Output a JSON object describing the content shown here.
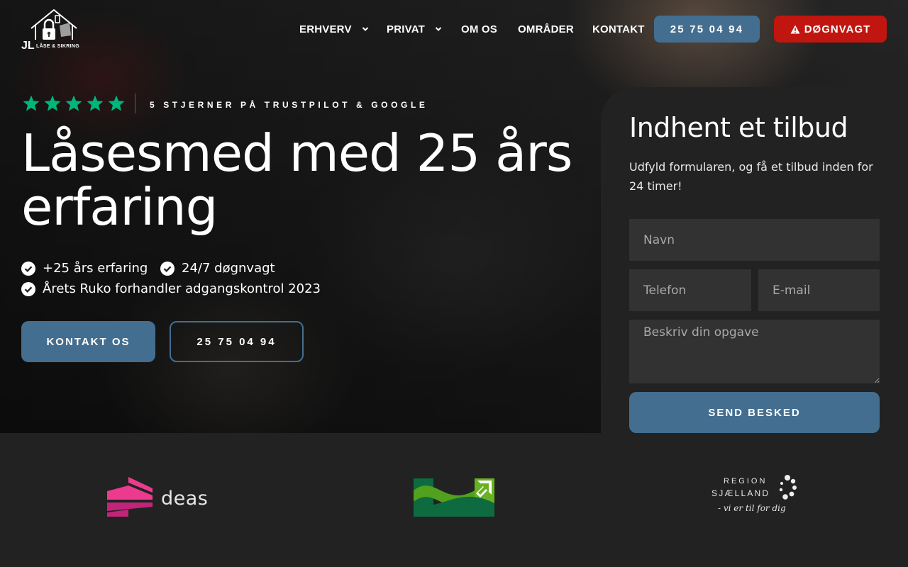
{
  "header": {
    "logo_text": "JL",
    "logo_subtext": "LÅSE & SIKRING",
    "nav": [
      {
        "label": "ERHVERV"
      },
      {
        "label": "PRIVAT"
      },
      {
        "label": "OM OS"
      },
      {
        "label": "OMRÅDER"
      },
      {
        "label": "KONTAKT"
      }
    ],
    "phone_button": "25 75 04 94",
    "emergency_button": "DØGNVAGT"
  },
  "hero": {
    "rating_stars": 5,
    "rating_text": "5 STJERNER PÅ TRUSTPILOT & GOOGLE",
    "headline": "Låsesmed med 25 års erfaring",
    "features": [
      "+25 års erfaring",
      "24/7 døgnvagt",
      "Årets Ruko forhandler adgangskontrol 2023"
    ],
    "contact_button": "KONTAKT OS",
    "phone_button": "25 75 04 94"
  },
  "form": {
    "title": "Indhent et tilbud",
    "description": "Udfyld formularen, og få et tilbud inden for 24 timer!",
    "name_placeholder": "Navn",
    "phone_placeholder": "Telefon",
    "email_placeholder": "E-mail",
    "task_placeholder": "Beskriv din opgave",
    "submit_button": "SEND BESKED"
  },
  "partners": {
    "deas": "deas",
    "region_line1": "REGION",
    "region_line2": "SJÆLLAND",
    "region_tagline": "- vi er til for dig"
  },
  "colors": {
    "brand_blue": "#436e90",
    "emergency_red": "#c0160f",
    "star_green": "#00b67a",
    "background": "#222222"
  }
}
